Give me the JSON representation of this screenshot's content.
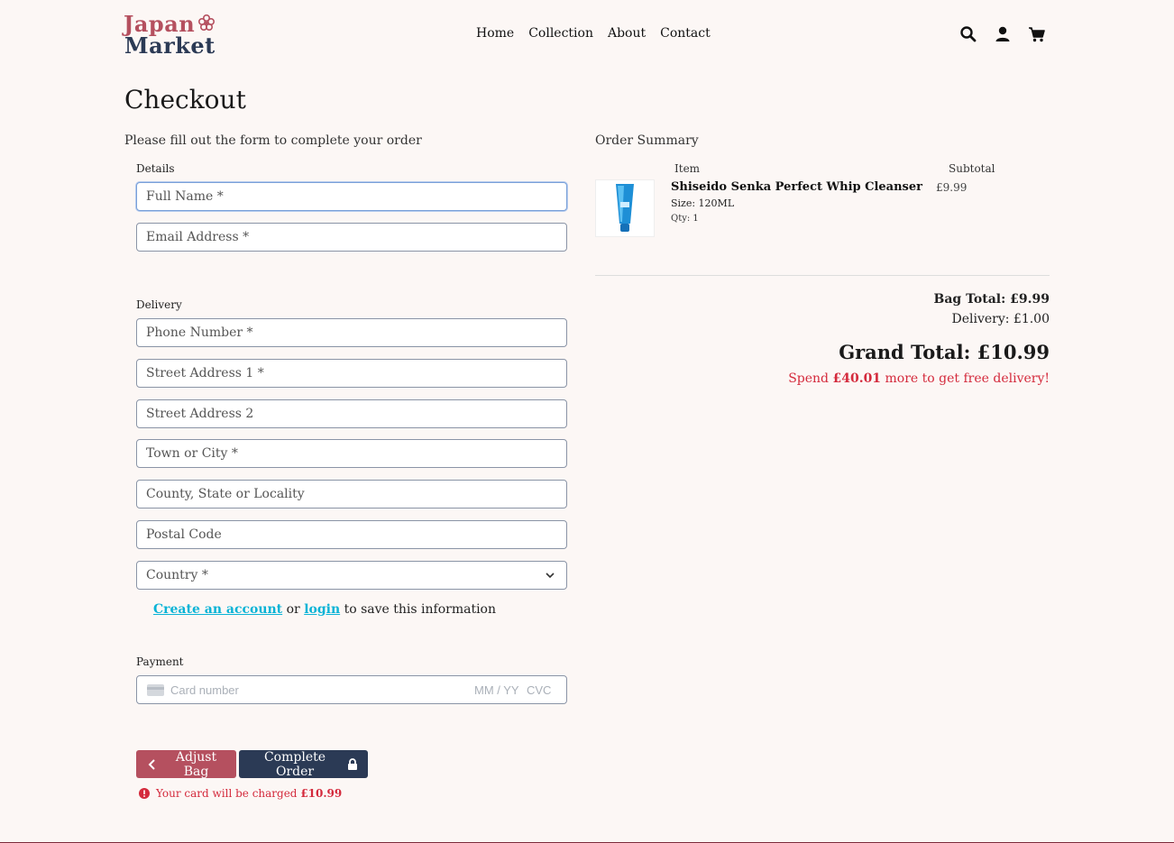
{
  "header": {
    "logo_line1": "Japan",
    "logo_line2": "Market",
    "nav": [
      "Home",
      "Collection",
      "About",
      "Contact"
    ],
    "icons": [
      "search-icon",
      "user-icon",
      "cart-icon"
    ]
  },
  "page": {
    "title": "Checkout",
    "intro": "Please fill out the form to complete your order"
  },
  "form": {
    "details_label": "Details",
    "full_name": "Full Name *",
    "email": "Email Address *",
    "delivery_label": "Delivery",
    "phone": "Phone Number *",
    "street1": "Street Address 1 *",
    "street2": "Street Address 2",
    "town": "Town or City *",
    "county": "County, State or Locality",
    "postcode": "Postal Code",
    "country": "Country *",
    "create_account": "Create an account",
    "or": "or",
    "login": "login",
    "save_info": "to save this information",
    "payment_label": "Payment",
    "card_placeholder": "Card number",
    "expiry_placeholder": "MM / YY",
    "cvc_placeholder": "CVC"
  },
  "buttons": {
    "adjust": "Adjust Bag",
    "complete": "Complete Order"
  },
  "charge_notice_prefix": "Your card will be charged",
  "charge_amount": "£10.99",
  "summary": {
    "title": "Order Summary",
    "col_item": "Item",
    "col_subtotal": "Subtotal",
    "product_name": "Shiseido Senka Perfect Whip Cleanser",
    "product_size": "Size: 120ML",
    "product_qty": "Qty: 1",
    "product_subtotal": "£9.99",
    "bag_total": "Bag Total: £9.99",
    "delivery": "Delivery: £1.00",
    "grand_total": "Grand Total: £10.99",
    "spend_prefix": "Spend",
    "spend_amount": "£40.01",
    "spend_suffix": "more to get free delivery!"
  },
  "colors": {
    "brand_red": "#b5505f",
    "brand_navy": "#2b3a55",
    "link_cyan": "#0ab3d6",
    "alert_red": "#d42a3c",
    "background": "#fcf7f5"
  }
}
